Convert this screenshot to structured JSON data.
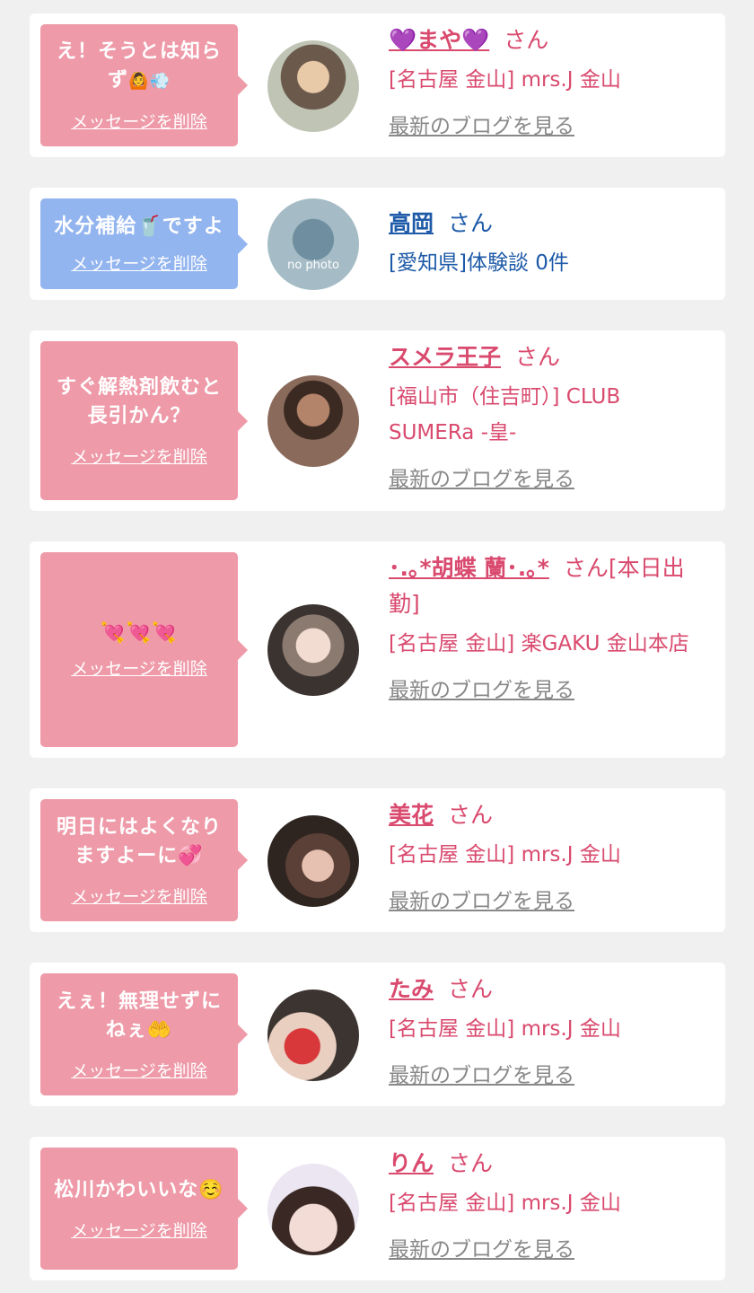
{
  "items": [
    {
      "bubble_message": "え！そうとは知らず",
      "bubble_emoji": "🙆💨",
      "delete_label": "メッセージを削除",
      "name": "💜まや💜",
      "honorific": "さん",
      "shop": "[名古屋 金山] mrs.J 金山",
      "blog_label": "最新のブログを見る"
    },
    {
      "bubble_message": "水分補給🥤ですよ",
      "delete_label": "メッセージを削除",
      "name": "高岡",
      "honorific": "さん",
      "shop": "[愛知県]体験談 0件",
      "avatar_text": "no photo"
    },
    {
      "bubble_message": "すぐ解熱剤飲むと長引かん？",
      "delete_label": "メッセージを削除",
      "name": "スメラ王子",
      "honorific": "さん",
      "shop": "[福山市（住吉町）] CLUB SUMERa -皇-",
      "blog_label": "最新のブログを見る"
    },
    {
      "bubble_message": "💘💘💘",
      "delete_label": "メッセージを削除",
      "name": "･.｡*胡蝶 蘭･.｡*",
      "honorific": "さん[本日出勤]",
      "shop": "[名古屋 金山] 楽GAKU 金山本店",
      "blog_label": "最新のブログを見る"
    },
    {
      "bubble_message": "明日にはよくなりますよーに💞",
      "delete_label": "メッセージを削除",
      "name": "美花",
      "honorific": "さん",
      "shop": "[名古屋 金山] mrs.J 金山",
      "blog_label": "最新のブログを見る"
    },
    {
      "bubble_message": "えぇ！無理せずにねぇ🤲",
      "delete_label": "メッセージを削除",
      "name": "たみ",
      "honorific": "さん",
      "shop": "[名古屋 金山] mrs.J 金山",
      "blog_label": "最新のブログを見る"
    },
    {
      "bubble_message": "松川かわいいな☺️",
      "delete_label": "メッセージを削除",
      "name": "りん",
      "honorific": "さん",
      "shop": "[名古屋 金山] mrs.J 金山",
      "blog_label": "最新のブログを見る"
    }
  ],
  "colors": {
    "background": "#f0f0f0",
    "card": "#ffffff",
    "bubble_pink": "#ee9aa8",
    "bubble_blue": "#92b4ef",
    "name_pink": "#d94a6e",
    "name_blue": "#1e5aa8",
    "blog_gray": "#888888"
  }
}
